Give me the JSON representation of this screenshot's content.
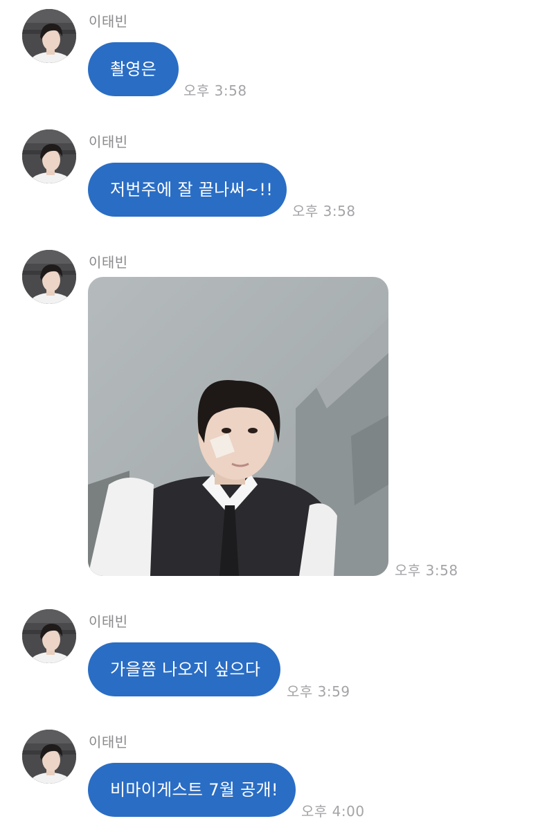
{
  "messages": [
    {
      "sender": "이태빈",
      "text": "촬영은",
      "time": "오후 3:58"
    },
    {
      "sender": "이태빈",
      "text": "저번주에 잘 끝나써~!!",
      "time": "오후 3:58"
    },
    {
      "sender": "이태빈",
      "image": "selfie-photo",
      "time": "오후 3:58"
    },
    {
      "sender": "이태빈",
      "text": "가을쯤 나오지 싶으다",
      "time": "오후 3:59"
    },
    {
      "sender": "이태빈",
      "text": "비마이게스트 7월 공개!",
      "time": "오후 4:00"
    }
  ],
  "colors": {
    "bubble": "#2a6dc4",
    "bubble_text": "#ffffff",
    "sender_text": "#8a8a8e",
    "timestamp_text": "#a4a4a8",
    "background": "#ffffff"
  },
  "icons": {
    "avatar": "profile-photo"
  }
}
